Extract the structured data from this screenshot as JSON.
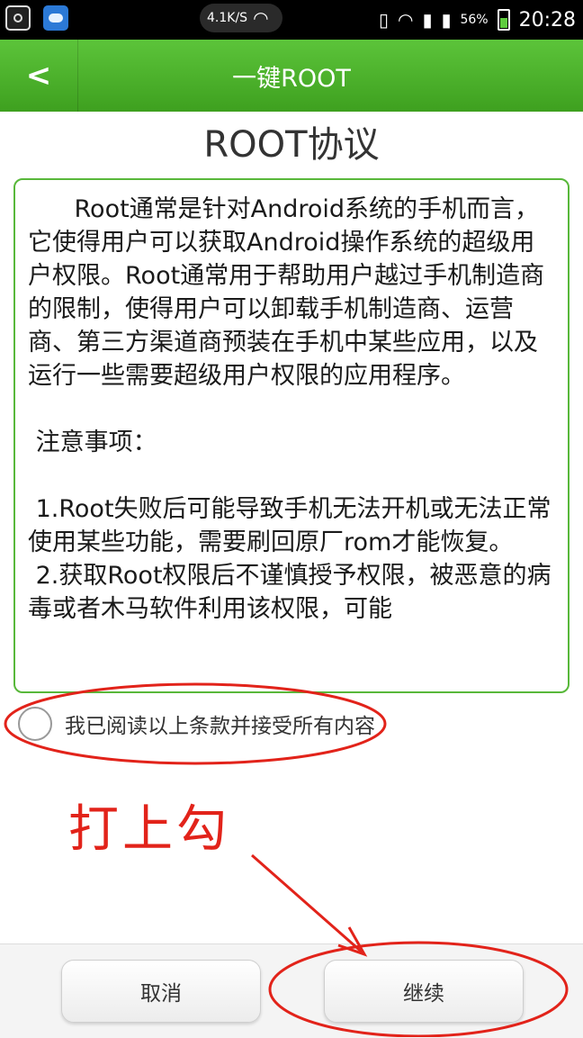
{
  "status_bar": {
    "net_speed": "4.1K/S",
    "battery_percent": "56%",
    "time": "20:28"
  },
  "header": {
    "back_label": "<",
    "title": "一键ROOT"
  },
  "agreement": {
    "heading": "ROOT协议",
    "body": "      Root通常是针对Android系统的手机而言，它使得用户可以获取Android操作系统的超级用户权限。Root通常用于帮助用户越过手机制造商的限制，使得用户可以卸载手机制造商、运营商、第三方渠道商预装在手机中某些应用，以及运行一些需要超级用户权限的应用程序。\n\n 注意事项：\n\n 1.Root失败后可能导致手机无法开机或无法正常使用某些功能，需要刷回原厂rom才能恢复。\n 2.获取Root权限后不谨慎授予权限，被恶意的病毒或者木马软件利用该权限，可能"
  },
  "accept": {
    "label": "我已阅读以上条款并接受所有内容",
    "checked": false
  },
  "annotation": {
    "text": "打上勾",
    "color": "#e2231a"
  },
  "buttons": {
    "cancel_label": "取消",
    "continue_label": "继续"
  },
  "colors": {
    "accent": "#4caf2a",
    "annotation": "#e2231a"
  }
}
